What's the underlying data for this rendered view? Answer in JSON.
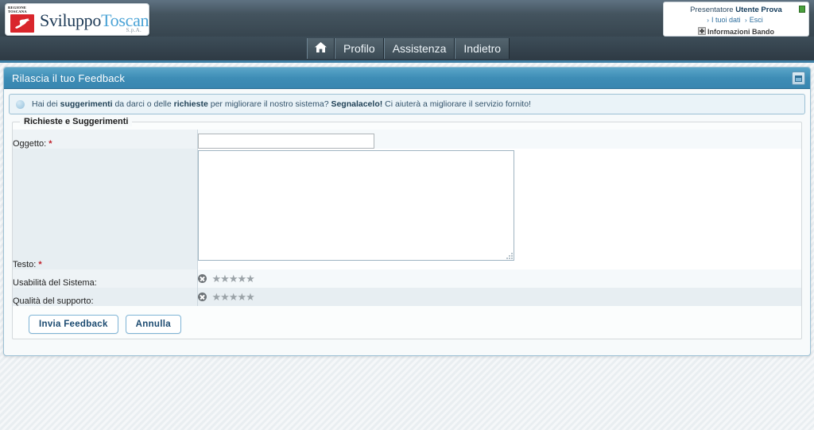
{
  "header": {
    "logo": {
      "crest_line1": "REGIONE",
      "crest_line2": "TOSCANA",
      "word_primary": "Sviluppo",
      "word_secondary": "Toscana",
      "suffix": "S.p.A."
    },
    "user_box": {
      "role_label": "Presentatore",
      "user_name": "Utente Prova",
      "link_dati": "I tuoi dati",
      "link_esci": "Esci",
      "chevron": "›",
      "bando_label": "Informazioni Bando"
    }
  },
  "nav": {
    "tabs": [
      {
        "label": "⌂",
        "name": "home"
      },
      {
        "label": "Profilo",
        "name": "profilo"
      },
      {
        "label": "Assistenza",
        "name": "assistenza"
      },
      {
        "label": "Indietro",
        "name": "indietro"
      }
    ]
  },
  "panel": {
    "title": "Rilascia il tuo Feedback",
    "title_icon": "restore-window-icon"
  },
  "info": {
    "icon": "info-bubble-icon",
    "part1": "Hai dei ",
    "bold1": "suggerimenti",
    "part2": " da darci o delle ",
    "bold2": "richieste",
    "part3": " per migliorare il nostro sistema? ",
    "bold3": "Segnalacelo!",
    "part4": " Ci aiuterà a migliorare il servizio fornito!"
  },
  "form": {
    "legend": "Richieste e Suggerimenti",
    "required_mark": "*",
    "oggetto": {
      "label": "Oggetto:",
      "value": "",
      "placeholder": ""
    },
    "testo": {
      "label": "Testo:",
      "value": "",
      "placeholder": ""
    },
    "usabilita": {
      "label": "Usabilità del Sistema:",
      "rating": 0,
      "max": 5,
      "star_glyph": "★",
      "cancel_icon": "cancel-rating-icon"
    },
    "qualita": {
      "label": "Qualità del supporto:",
      "rating": 0,
      "max": 5,
      "star_glyph": "★",
      "cancel_icon": "cancel-rating-icon"
    },
    "submit_label": "Invia Feedback",
    "cancel_label": "Annulla"
  },
  "colors": {
    "accent": "#3e8db6",
    "header_dark": "#37454f",
    "required_red": "#c0202a",
    "link_blue": "#2f6f9e",
    "logo_blue": "#4aa3d6"
  }
}
